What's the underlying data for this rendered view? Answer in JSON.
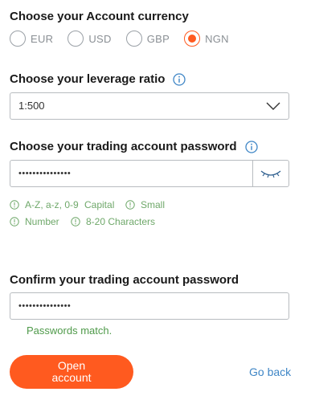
{
  "currency": {
    "heading": "Choose your Account currency",
    "options": [
      {
        "label": "EUR",
        "selected": false
      },
      {
        "label": "USD",
        "selected": false
      },
      {
        "label": "GBP",
        "selected": false
      },
      {
        "label": "NGN",
        "selected": true
      }
    ]
  },
  "leverage": {
    "heading": "Choose your leverage ratio",
    "info_icon": "info-icon",
    "selected_value": "1:500",
    "dropdown_icon": "chevron-down-icon"
  },
  "password": {
    "heading": "Choose your trading account password",
    "info_icon": "info-icon",
    "masked_value": "•••••••••••••••",
    "toggle_icon": "eye-closed-icon",
    "requirements": [
      {
        "label": "A-Z, a-z, 0-9"
      },
      {
        "label": "Capital"
      },
      {
        "label": "Small"
      },
      {
        "label": "Number"
      },
      {
        "label": "8-20 Characters"
      }
    ]
  },
  "confirm": {
    "heading": "Confirm your trading account password",
    "masked_value": "•••••••••••••••",
    "status_text": "Passwords match."
  },
  "actions": {
    "open_account_label": "Open account",
    "go_back_label": "Go back"
  },
  "colors": {
    "accent": "#ff5a1f",
    "success": "#6fa86a",
    "link": "#3f86c6"
  }
}
